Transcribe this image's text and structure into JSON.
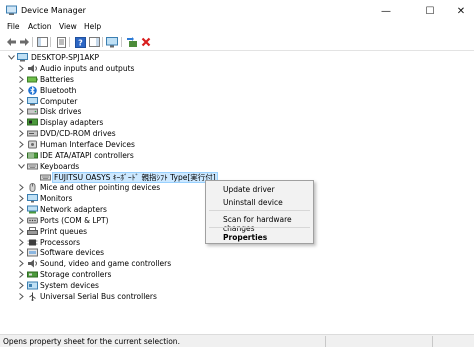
{
  "window": {
    "title": "Device Manager"
  },
  "menu": [
    "File",
    "Action",
    "View",
    "Help"
  ],
  "toolbar": [
    {
      "icon": "back-arrow-icon"
    },
    {
      "icon": "forward-arrow-icon"
    },
    {
      "icon": "show-hide-console-tree-icon"
    },
    {
      "icon": "properties-sheet-icon"
    },
    {
      "icon": "help-icon"
    },
    {
      "icon": "action-pane-icon"
    },
    {
      "icon": "monitor-icon"
    },
    {
      "icon": "update-driver-icon"
    },
    {
      "icon": "uninstall-red-x-icon"
    }
  ],
  "tree": {
    "root": "DESKTOP-SPJ1AKP",
    "categories": [
      {
        "label": "Audio inputs and outputs",
        "icon": "speaker-icon",
        "expanded": false
      },
      {
        "label": "Batteries",
        "icon": "battery-icon",
        "expanded": false
      },
      {
        "label": "Bluetooth",
        "icon": "bluetooth-icon",
        "expanded": false
      },
      {
        "label": "Computer",
        "icon": "computer-icon",
        "expanded": false
      },
      {
        "label": "Disk drives",
        "icon": "disk-drive-icon",
        "expanded": false
      },
      {
        "label": "Display adapters",
        "icon": "display-adapter-icon",
        "expanded": false
      },
      {
        "label": "DVD/CD-ROM drives",
        "icon": "dvd-drive-icon",
        "expanded": false
      },
      {
        "label": "Human Interface Devices",
        "icon": "hid-icon",
        "expanded": false
      },
      {
        "label": "IDE ATA/ATAPI controllers",
        "icon": "ide-controller-icon",
        "expanded": false
      },
      {
        "label": "Keyboards",
        "icon": "keyboard-icon",
        "expanded": true
      },
      {
        "label": "FUJITSU OASYS ｷｰﾎﾞｰﾄﾞ 親指ｼﾌﾄ Type[実行付]",
        "icon": "keyboard-icon",
        "child": true,
        "selected": true
      },
      {
        "label": "Mice and other pointing devices",
        "icon": "mouse-icon",
        "expanded": false
      },
      {
        "label": "Monitors",
        "icon": "monitor-icon",
        "expanded": false
      },
      {
        "label": "Network adapters",
        "icon": "network-adapter-icon",
        "expanded": false
      },
      {
        "label": "Ports (COM & LPT)",
        "icon": "port-icon",
        "expanded": false
      },
      {
        "label": "Print queues",
        "icon": "printer-icon",
        "expanded": false
      },
      {
        "label": "Processors",
        "icon": "processor-icon",
        "expanded": false
      },
      {
        "label": "Software devices",
        "icon": "software-device-icon",
        "expanded": false
      },
      {
        "label": "Sound, video and game controllers",
        "icon": "sound-icon",
        "expanded": false
      },
      {
        "label": "Storage controllers",
        "icon": "storage-controller-icon",
        "expanded": false
      },
      {
        "label": "System devices",
        "icon": "system-device-icon",
        "expanded": false
      },
      {
        "label": "Universal Serial Bus controllers",
        "icon": "usb-icon",
        "expanded": false
      }
    ]
  },
  "context_menu": {
    "items": [
      "Update driver",
      "Uninstall device",
      "Scan for hardware changes",
      "Properties"
    ]
  },
  "status": {
    "text": "Opens property sheet for the current selection."
  },
  "colors": {
    "selection_bg": "#cce8ff",
    "selection_border": "#99d1ff",
    "menu_bg": "#f2f2f2",
    "status_bg": "#f0f0f0"
  }
}
